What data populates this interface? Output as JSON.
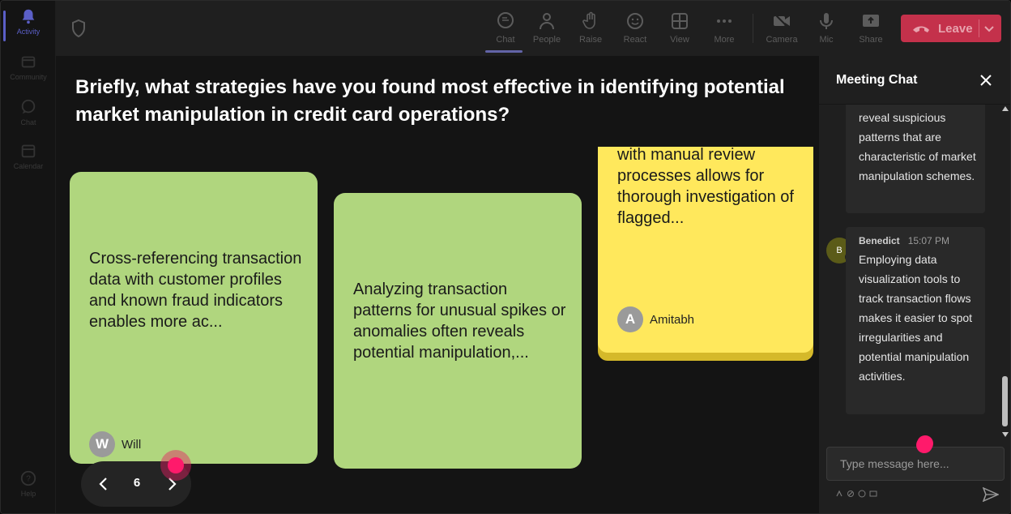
{
  "rail": {
    "items": [
      {
        "label": "Activity",
        "icon": "bell-icon",
        "active": true
      },
      {
        "label": "Community",
        "icon": "community-icon"
      },
      {
        "label": "Chat",
        "icon": "chat-icon"
      },
      {
        "label": "Calendar",
        "icon": "calendar-icon"
      },
      {
        "label": "Help",
        "icon": "help-icon"
      }
    ]
  },
  "toolbar": {
    "tools": [
      {
        "label": "Chat",
        "icon": "chat-icon",
        "active": true
      },
      {
        "label": "People",
        "icon": "people-icon"
      },
      {
        "label": "Raise",
        "icon": "raise-hand-icon"
      },
      {
        "label": "React",
        "icon": "react-icon"
      },
      {
        "label": "View",
        "icon": "view-grid-icon"
      },
      {
        "label": "More",
        "icon": "more-icon"
      },
      {
        "label": "Camera",
        "icon": "camera-off-icon"
      },
      {
        "label": "Mic",
        "icon": "mic-icon"
      },
      {
        "label": "Share",
        "icon": "share-icon"
      }
    ],
    "leave_label": "Leave"
  },
  "board": {
    "question": "Briefly, what strategies have you found most effective in identifying potential market manipulation in credit card operations?",
    "cards": [
      {
        "text": "Cross-referencing transaction data with customer profiles and known fraud indicators enables more ac...",
        "author": "Will",
        "initial": "W",
        "color": "green"
      },
      {
        "text": "Analyzing transaction patterns for unusual spikes or anomalies often reveals potential manipulation,...",
        "color": "green"
      },
      {
        "text": "with manual review processes allows for thorough investigation of flagged...",
        "author": "Amitabh",
        "initial": "A",
        "color": "yellow"
      }
    ],
    "page": "6"
  },
  "chat": {
    "title": "Meeting Chat",
    "messages": [
      {
        "text": "reveal suspicious patterns that are characteristic of market manipulation schemes."
      },
      {
        "author": "Benedict",
        "time": "15:07 PM",
        "initial": "B",
        "text": "Employing data visualization tools to track transaction flows makes it easier to spot irregularities and potential manipulation activities."
      }
    ],
    "input_placeholder": "Type message here..."
  },
  "colors": {
    "accent": "#5b5fc7",
    "leave": "#c4314b",
    "card_green": "#b0d67e",
    "card_yellow": "#ffe85c",
    "marker": "#ff1a6b"
  }
}
